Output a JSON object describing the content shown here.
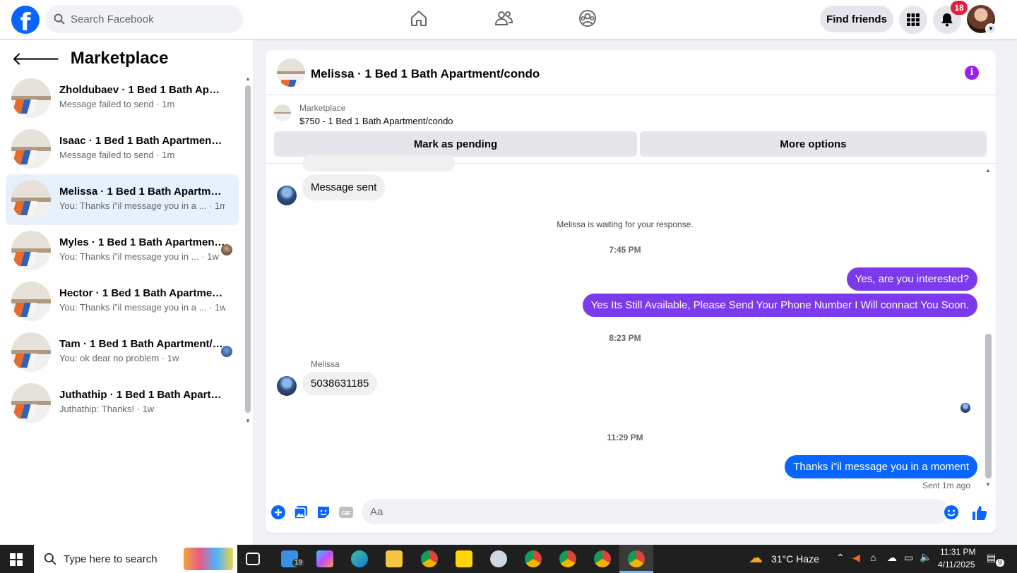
{
  "topbar": {
    "logo": "f",
    "search_placeholder": "Search Facebook",
    "find_friends": "Find friends",
    "notification_count": "18",
    "icons": [
      "facebook-logo",
      "search-icon",
      "home-icon",
      "friends-icon",
      "groups-icon",
      "menu-grid-icon",
      "bell-icon",
      "profile-avatar"
    ]
  },
  "sidebar": {
    "title": "Marketplace",
    "conversations": [
      {
        "title": "Zholdubaev · 1 Bed 1 Bath Apartment/condo",
        "subtitle": "Message failed to send · 1m"
      },
      {
        "title": "Isaac · 1 Bed 1 Bath Apartment/condo",
        "subtitle": "Message failed to send · 1m"
      },
      {
        "title": "Melissa · 1 Bed 1 Bath Apartment/condo",
        "subtitle": "You: Thanks i\"il message you in a ...  · 1m"
      },
      {
        "title": "Myles · 1 Bed 1 Bath Apartment/condo",
        "subtitle": "You: Thanks i\"il message you in ...  · 1w"
      },
      {
        "title": "Hector · 1 Bed 1 Bath Apartment/condo",
        "subtitle": "You: Thanks i\"il message you in a ...  · 1w"
      },
      {
        "title": "Tam · 1 Bed 1 Bath Apartment/condo",
        "subtitle": "You: ok dear no problem · 1w"
      },
      {
        "title": "Juthathip · 1 Bed 1 Bath Apartment/condo",
        "subtitle": "Juthathip: Thanks! · 1w"
      }
    ]
  },
  "chat": {
    "title": "Melissa · 1 Bed 1 Bath Apartment/condo",
    "listing_label": "Marketplace",
    "listing_price": "$750 - 1 Bed 1 Bath Apartment/condo",
    "mark_pending": "Mark as pending",
    "more_options": "More options",
    "messages": {
      "sent_notice": "Message sent",
      "waiting": "Melissa is waiting for your response.",
      "time1": "7:45 PM",
      "out1": "Yes, are you interested?",
      "out2": "Yes Its Still Available, Please Send Your Phone Number I Will connact You Soon.",
      "time2": "8:23 PM",
      "sender": "Melissa",
      "in_phone": "5038631185",
      "time3": "11:29 PM",
      "out3": "Thanks i\"il message you in a moment",
      "sent_status": "Sent 1m ago"
    },
    "composer_placeholder": "Aa",
    "accent_purple": "#7c3aed",
    "accent_blue": "#0866ff"
  },
  "taskbar": {
    "search_placeholder": "Type here to search",
    "badge_19": "19",
    "weather": "31°C  Haze",
    "time": "11:31 PM",
    "date": "4/11/2025",
    "notif_count": "9"
  }
}
